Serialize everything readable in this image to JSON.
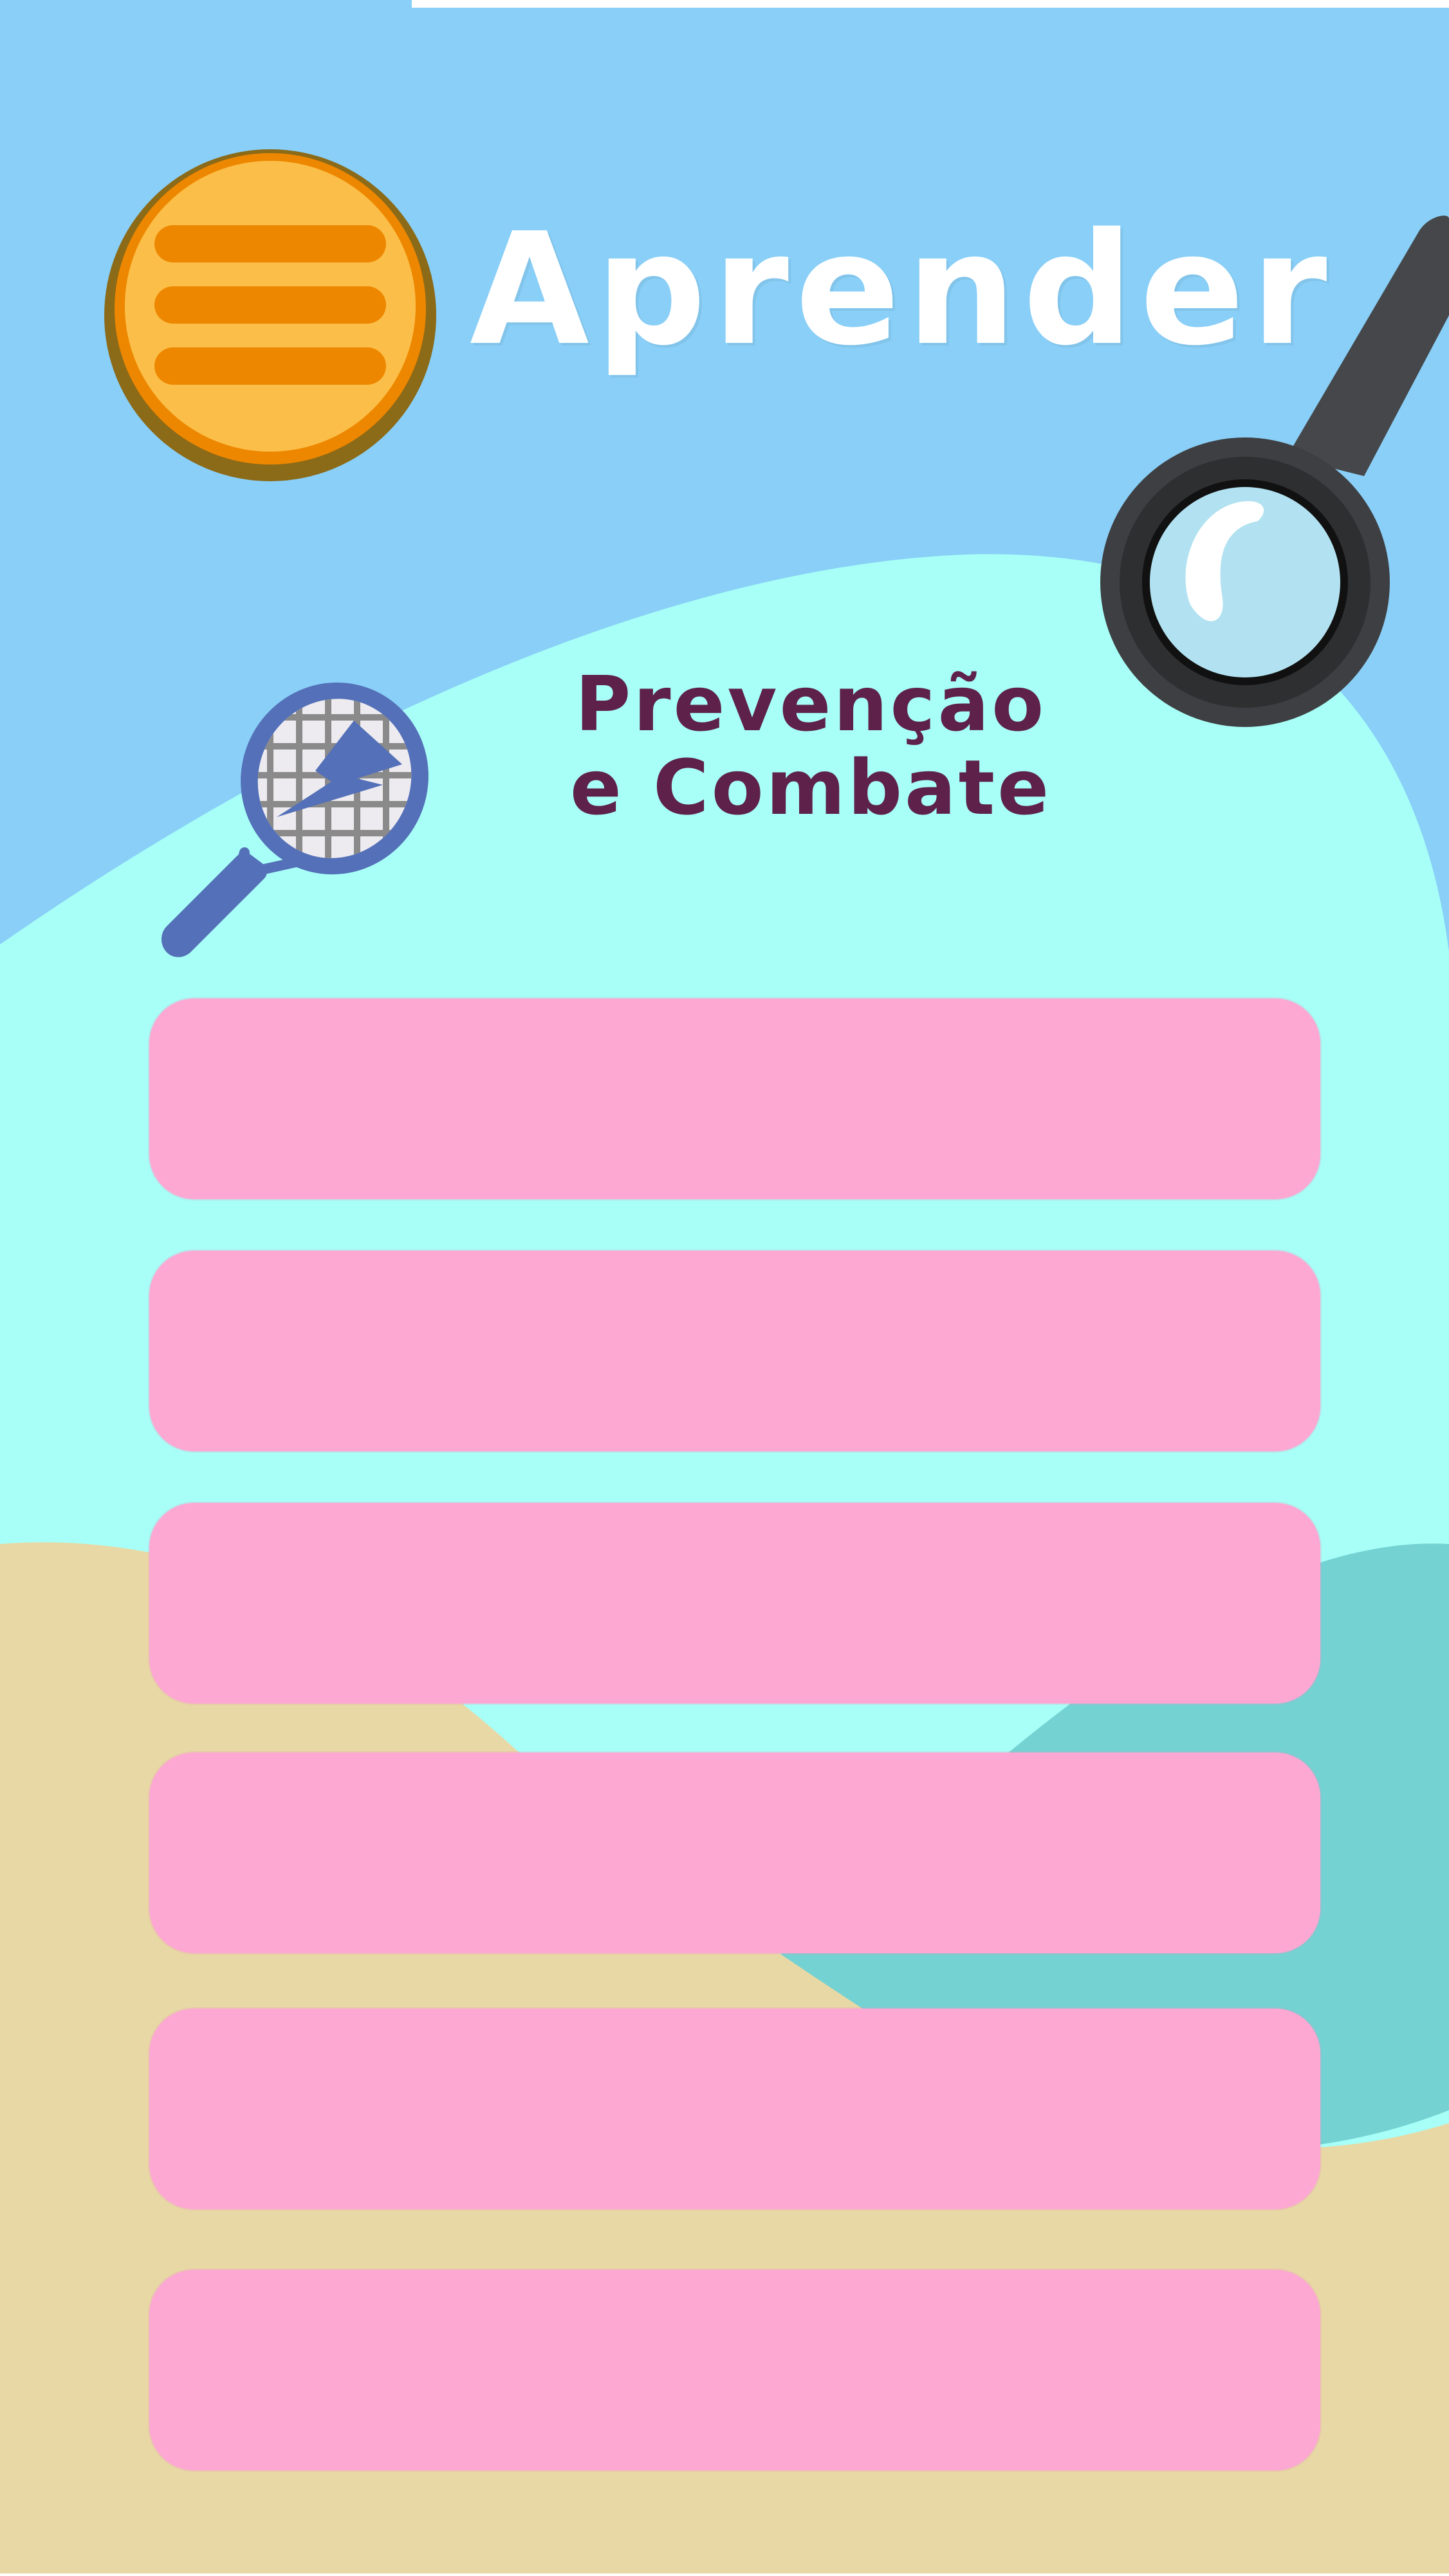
{
  "app": {
    "title": "Aprender"
  },
  "section": {
    "title_line1": "Prevenção",
    "title_line2": "e Combate"
  },
  "icons": {
    "menu": "menu-icon",
    "magnifier": "magnifying-glass-icon",
    "racket": "electric-racket-icon"
  },
  "option_buttons": [
    {
      "label": ""
    },
    {
      "label": ""
    },
    {
      "label": ""
    },
    {
      "label": ""
    },
    {
      "label": ""
    },
    {
      "label": ""
    }
  ],
  "colors": {
    "sky": "#89CFF7",
    "aqua": "#A8FFF7",
    "teal": "#74D2D3",
    "sand": "#E8D8A5",
    "option_button": "#FDA8D3",
    "title_text": "#FFFFFF",
    "section_title_text": "#5E224A",
    "menu_orange": "#FBBF49",
    "menu_line": "#EE8700"
  }
}
